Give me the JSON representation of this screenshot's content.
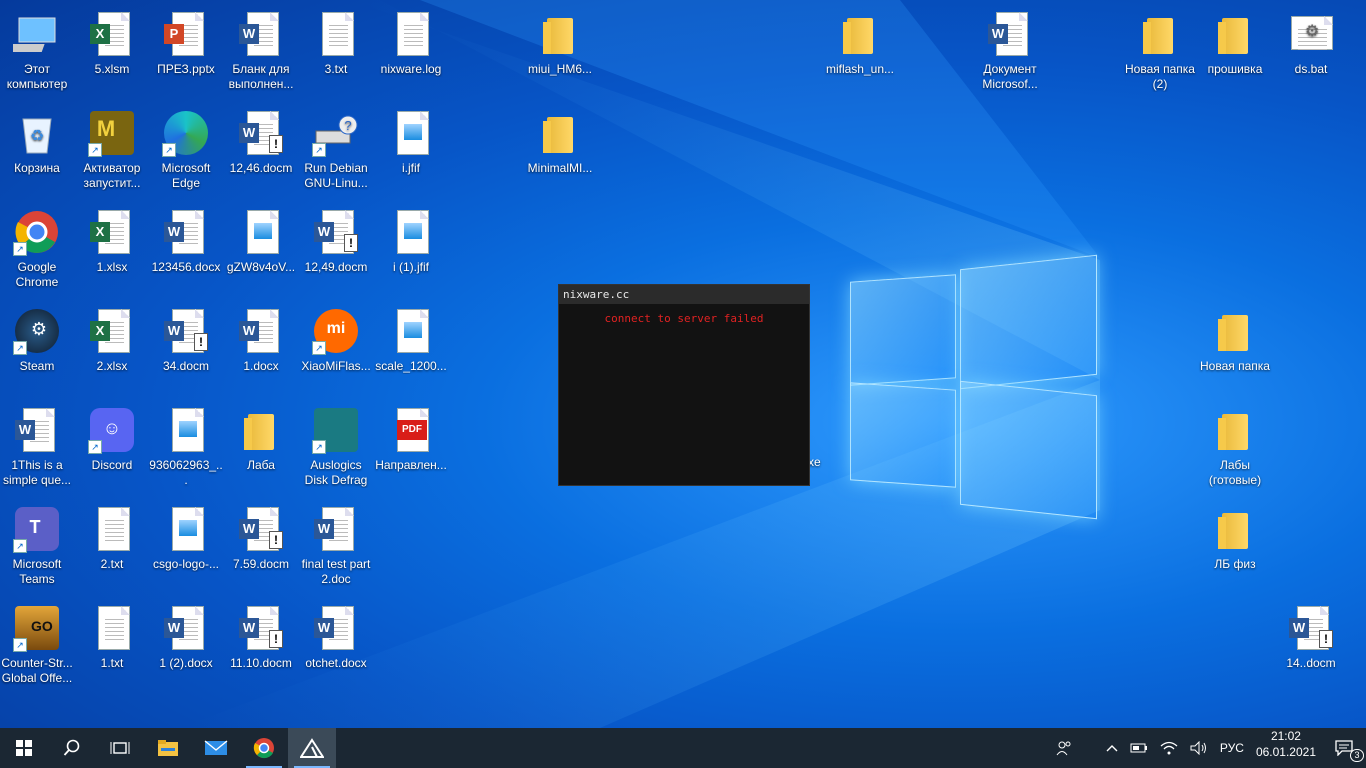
{
  "desktop": {
    "icons": [
      {
        "label": "Этот компьютер",
        "type": "computer"
      },
      {
        "label": "5.xlsm",
        "type": "excel"
      },
      {
        "label": "ПРЕЗ.pptx",
        "type": "ppt"
      },
      {
        "label": "Бланк для выполнен...",
        "type": "word"
      },
      {
        "label": "3.txt",
        "type": "txt"
      },
      {
        "label": "nixware.log",
        "type": "txt"
      },
      {
        "label": "miui_HM6...",
        "type": "folder"
      },
      {
        "label": "miflash_un...",
        "type": "folder"
      },
      {
        "label": "Документ Microsof...",
        "type": "word"
      },
      {
        "label": "Новая папка (2)",
        "type": "folder"
      },
      {
        "label": "прошивка",
        "type": "folder"
      },
      {
        "label": "ds.bat",
        "type": "bat"
      },
      {
        "label": "Корзина",
        "type": "recycle"
      },
      {
        "label": "Активатор запустит...",
        "type": "activator"
      },
      {
        "label": "Microsoft Edge",
        "type": "edge"
      },
      {
        "label": "12,46.docm",
        "type": "word-macro"
      },
      {
        "label": "Run Debian GNU-Linu...",
        "type": "debian"
      },
      {
        "label": "i.jfif",
        "type": "image"
      },
      {
        "label": "MinimalMI...",
        "type": "folder"
      },
      {
        "label": "Google Chrome",
        "type": "chrome"
      },
      {
        "label": "1.xlsx",
        "type": "excel"
      },
      {
        "label": "123456.docx",
        "type": "word"
      },
      {
        "label": "gZW8v4oV...",
        "type": "image"
      },
      {
        "label": "12,49.docm",
        "type": "word-macro"
      },
      {
        "label": "i (1).jfif",
        "type": "image"
      },
      {
        "label": "Steam",
        "type": "steam"
      },
      {
        "label": "2.xlsx",
        "type": "excel"
      },
      {
        "label": "34.docm",
        "type": "word-macro"
      },
      {
        "label": "1.docx",
        "type": "word"
      },
      {
        "label": "XiaoMiFlas...",
        "type": "mi"
      },
      {
        "label": "scale_1200...",
        "type": "image"
      },
      {
        "label": "Новая папка",
        "type": "folder"
      },
      {
        "label": "1This is a simple que...",
        "type": "word"
      },
      {
        "label": "Discord",
        "type": "discord"
      },
      {
        "label": "936062963_...",
        "type": "image"
      },
      {
        "label": "Лаба",
        "type": "folder"
      },
      {
        "label": "Auslogics Disk Defrag",
        "type": "auslogics"
      },
      {
        "label": "Направлен...",
        "type": "pdf"
      },
      {
        "label": "Лабы (готовые)",
        "type": "folder"
      },
      {
        "label": "Microsoft Teams",
        "type": "teams"
      },
      {
        "label": "2.txt",
        "type": "txt"
      },
      {
        "label": "csgo-logo-...",
        "type": "image"
      },
      {
        "label": "7.59.docm",
        "type": "word-macro"
      },
      {
        "label": "final test part 2.doc",
        "type": "word"
      },
      {
        "label": "ЛБ физ",
        "type": "folder"
      },
      {
        "label": "Counter-Str... Global Offe...",
        "type": "csgo"
      },
      {
        "label": "1.txt",
        "type": "txt"
      },
      {
        "label": "1 (2).docx",
        "type": "word"
      },
      {
        "label": "11.10.docm",
        "type": "word-macro"
      },
      {
        "label": "otchet.docx",
        "type": "word"
      },
      {
        "label": "14..docm",
        "type": "word-macro"
      }
    ],
    "hidden_label_fragment": "xe"
  },
  "console": {
    "title": "nixware.cc",
    "message": "connect to server failed"
  },
  "taskbar": {
    "language": "РУС",
    "time": "21:02",
    "date": "06.01.2021",
    "notifications": "3",
    "pinned": [
      "start-icon",
      "search-icon",
      "task-view-icon",
      "file-explorer-icon",
      "mail-icon",
      "chrome-icon",
      "nixware-app-icon"
    ]
  },
  "colors": {
    "console_text": "#e02222",
    "taskbar": "#1b2733"
  }
}
